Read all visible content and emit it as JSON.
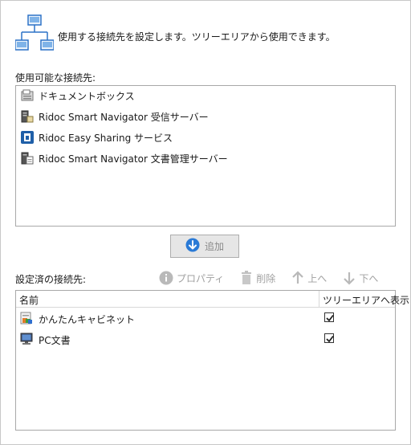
{
  "header": {
    "description": "使用する接続先を設定します。ツリーエリアから使用できます。"
  },
  "available": {
    "label": "使用可能な接続先:",
    "items": [
      {
        "label": "ドキュメントボックス",
        "icon": "document-box-icon"
      },
      {
        "label": "Ridoc Smart Navigator 受信サーバー",
        "icon": "receive-server-icon"
      },
      {
        "label": "Ridoc Easy Sharing サービス",
        "icon": "easy-sharing-icon"
      },
      {
        "label": "Ridoc Smart Navigator 文書管理サーバー",
        "icon": "document-server-icon"
      }
    ]
  },
  "add_button": {
    "label": "追加",
    "icon": "arrow-down-circle-icon"
  },
  "configured": {
    "label": "設定済の接続先:",
    "toolbar": {
      "properties": "プロパティ",
      "delete": "削除",
      "up": "上へ",
      "down": "下へ"
    },
    "columns": {
      "name": "名前",
      "show": "ツリーエリアへ表示"
    },
    "rows": [
      {
        "name": "かんたんキャビネット",
        "icon": "cabinet-icon",
        "checked": true
      },
      {
        "name": "PC文書",
        "icon": "monitor-icon",
        "checked": true
      }
    ]
  },
  "colors": {
    "accent": "#2a7ad6",
    "border": "#a8a8a8",
    "disabled": "#a0a0a0"
  }
}
